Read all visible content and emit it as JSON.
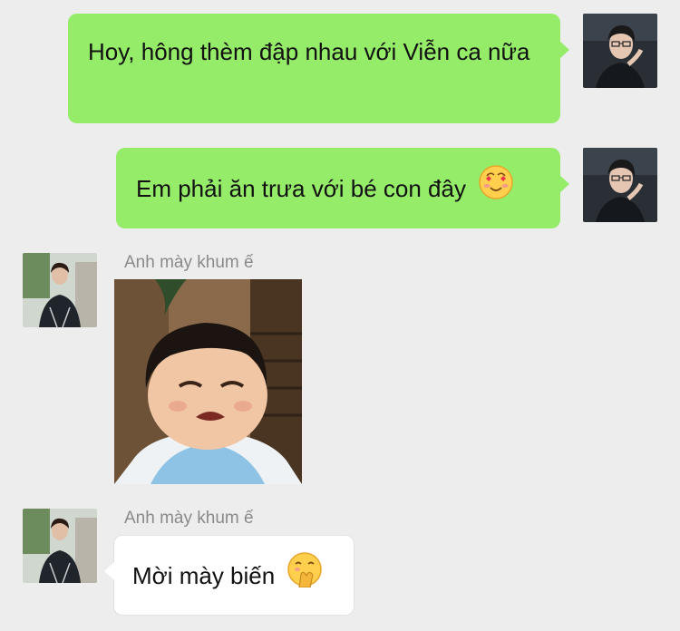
{
  "messages": [
    {
      "direction": "outgoing",
      "text": "Hoy, hông thèm đập nhau với Viễn ca nữa",
      "avatar": "self-avatar"
    },
    {
      "direction": "outgoing",
      "text": "Em phải ăn trưa với bé con đây",
      "emoji": "smiling-face-with-heart-eyes-icon",
      "avatar": "self-avatar"
    },
    {
      "direction": "incoming",
      "sender": "Anh mày khum ế",
      "type": "image",
      "image": "crying-child-sticker",
      "avatar": "contact-avatar"
    },
    {
      "direction": "incoming",
      "sender": "Anh mày khum ế",
      "text": "Mời mày biến",
      "emoji": "hand-over-mouth-emoji-icon",
      "avatar": "contact-avatar"
    }
  ],
  "colors": {
    "background": "#ededed",
    "outgoing_bubble": "#95ec69",
    "incoming_bubble": "#ffffff",
    "sender_name": "#8a8a8a"
  }
}
